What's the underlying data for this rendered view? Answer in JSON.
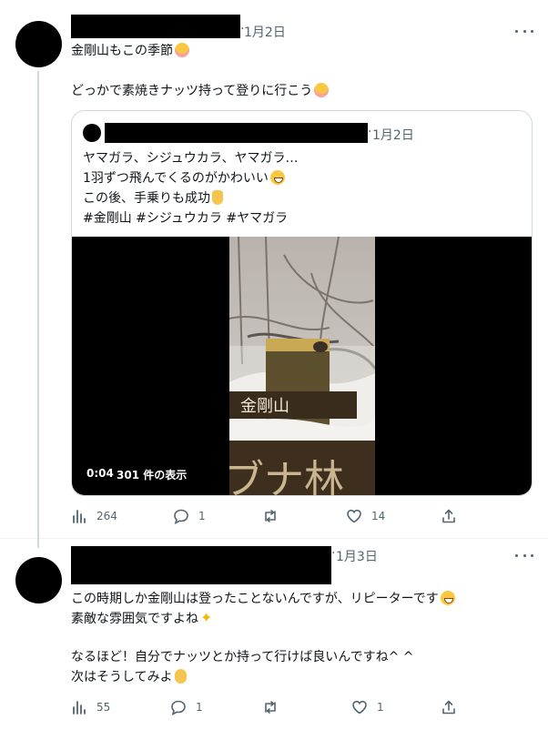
{
  "tweet1": {
    "date": "1月2日",
    "dot": "·",
    "lines": [
      "金剛山もこの季節",
      "どっかで素焼きナッツ持って登りに行こう"
    ],
    "quote": {
      "date": "1月2日",
      "dot": "·",
      "lines": [
        "ヤマガラ、シジュウカラ、ヤマガラ…",
        "1羽ずつ飛んでくるのがかわいい",
        "この後、手乗りも成功",
        "#金剛山 #シジュウカラ #ヤマガラ"
      ],
      "media": {
        "time": "0:04",
        "views": "301 件の表示",
        "sign_text": "金剛山",
        "board_text": "ブナ林"
      }
    },
    "stats": {
      "views": "264",
      "replies": "1",
      "retweets": "",
      "likes": "14"
    }
  },
  "tweet2": {
    "date": "1月3日",
    "dot": "·",
    "lines": [
      "この時期しか金剛山は登ったことないんですが、リピーターです",
      "素敵な雰囲気ですよね",
      "なるほど！自分でナッツとか持って行けば良いんですね^ ^",
      "次はそうしてみよ"
    ],
    "stats": {
      "views": "55",
      "replies": "1",
      "retweets": "",
      "likes": "1"
    }
  },
  "icons": [
    "more-icon",
    "views-icon",
    "reply-icon",
    "retweet-icon",
    "like-icon",
    "share-icon"
  ],
  "colors": {
    "text": "#0f1419",
    "muted": "#536471",
    "border": "#cfd9de"
  }
}
